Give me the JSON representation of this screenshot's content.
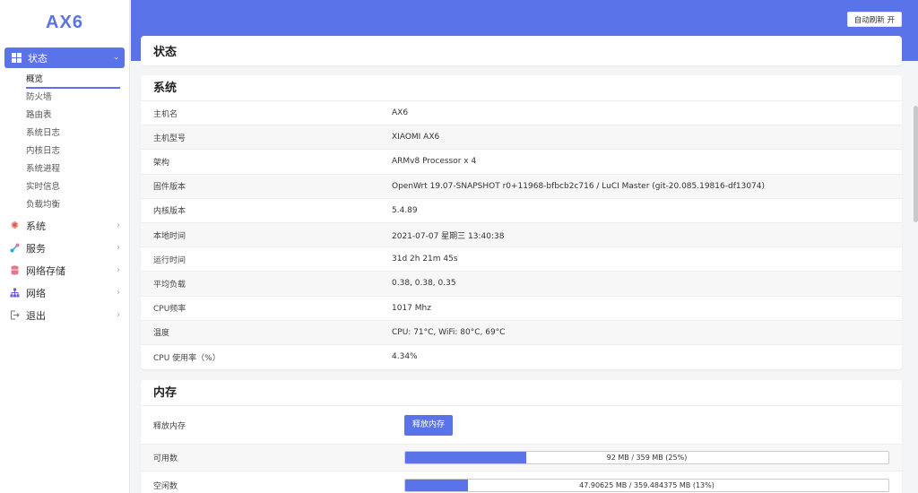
{
  "logo": "AX6",
  "sidebar": {
    "active": {
      "label": "状态",
      "chevron_icon": "chevron-down-icon"
    },
    "sub_items": [
      {
        "label": "概览"
      },
      {
        "label": "防火墙"
      },
      {
        "label": "路由表"
      },
      {
        "label": "系统日志"
      },
      {
        "label": "内核日志"
      },
      {
        "label": "系统进程"
      },
      {
        "label": "实时信息"
      },
      {
        "label": "负载均衡"
      }
    ],
    "items": [
      {
        "label": "系统",
        "icon": "gear-icon",
        "color": "#e05a4f"
      },
      {
        "label": "服务",
        "icon": "share-icon",
        "color": "#2aa7d6"
      },
      {
        "label": "网络存储",
        "icon": "database-icon",
        "color": "#e07a8a"
      },
      {
        "label": "网络",
        "icon": "network-icon",
        "color": "#6b5bd6"
      },
      {
        "label": "退出",
        "icon": "logout-icon",
        "color": "#777777"
      }
    ]
  },
  "topbar": {
    "refresh_label": "自动刷新 开"
  },
  "page_title": "状态",
  "system": {
    "title": "系统",
    "rows": [
      {
        "k": "主机名",
        "v": "AX6"
      },
      {
        "k": "主机型号",
        "v": "XIAOMI AX6"
      },
      {
        "k": "架构",
        "v": "ARMv8 Processor x 4"
      },
      {
        "k": "固件版本",
        "v": "OpenWrt 19.07-SNAPSHOT r0+11968-bfbcb2c716 / LuCI Master (git-20.085.19816-df13074)"
      },
      {
        "k": "内核版本",
        "v": "5.4.89"
      },
      {
        "k": "本地时间",
        "v": "2021-07-07 星期三 13:40:38"
      },
      {
        "k": "运行时间",
        "v": "31d 2h 21m 45s"
      },
      {
        "k": "平均负载",
        "v": "0.38, 0.38, 0.35"
      },
      {
        "k": "CPU频率",
        "v": "1017 Mhz"
      },
      {
        "k": "温度",
        "v": "CPU: 71°C, WiFi: 80°C, 69°C"
      },
      {
        "k": "CPU 使用率（%）",
        "v": "4.34%"
      }
    ]
  },
  "memory": {
    "title": "内存",
    "free_label": "释放内存",
    "free_button": "释放内存",
    "bars": [
      {
        "k": "可用数",
        "text": "92 MB / 359 MB (25%)",
        "fraction": 0.25
      },
      {
        "k": "空闲数",
        "text": "47.90625 MB / 359.484375 MB (13%)",
        "fraction": 0.13
      }
    ]
  },
  "colors": {
    "accent": "#5b73e8"
  }
}
